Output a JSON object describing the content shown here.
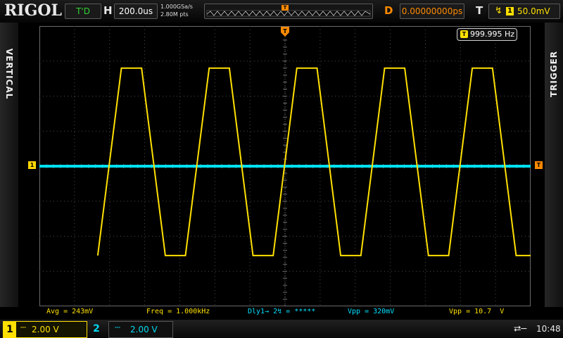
{
  "topbar": {
    "logo": "RIGOL",
    "run_state": "T'D",
    "h_label": "H",
    "timebase": "200.0us",
    "sample_rate": "1.000GSa/s",
    "memory_depth": "2.80M pts",
    "d_label": "D",
    "delay": "0.00000000ps",
    "t_label": "T",
    "trigger_source": "1",
    "trigger_level": "50.0mV",
    "trigger_edge_icon": "rising-edge-icon"
  },
  "sidebar": {
    "left_tab": "VERTICAL",
    "right_tab": "TRIGGER"
  },
  "display": {
    "freq_counter": "999.995 Hz",
    "freq_counter_icon": "T",
    "ch1_marker": "1",
    "trigger_level_marker": "T",
    "grid_divisions": {
      "x": 14,
      "y": 8
    }
  },
  "waveforms": {
    "ch1": {
      "color": "#ffe000",
      "shape": "trapezoid",
      "period_div": 2.5,
      "high_div": 2.8,
      "low_div": -2.55
    },
    "ch2": {
      "color": "#00e0f0",
      "shape": "flat",
      "level_div": 0
    }
  },
  "measurements": [
    {
      "text": "Avg = 243mV",
      "color": "yellow"
    },
    {
      "text": "Freq = 1.000kHz",
      "color": "yellow"
    },
    {
      "text": "Dly1→ 2↯ = *****",
      "color": "cyan"
    },
    {
      "text": "Vpp = 320mV",
      "color": "cyan"
    },
    {
      "text": "Vpp = 10.7  V",
      "color": "yellow"
    }
  ],
  "bottombar": {
    "ch1": {
      "num": "1",
      "coupling": "⎓",
      "scale": "2.00 V"
    },
    "ch2": {
      "num": "2",
      "coupling": "⎓",
      "scale": "2.00 V"
    },
    "usb_icon": "usb-icon",
    "time": "10:48"
  },
  "colors": {
    "ch1": "#ffe000",
    "ch2": "#00e0f0",
    "trigger": "#ff8a00",
    "run_state": "#32d232"
  }
}
